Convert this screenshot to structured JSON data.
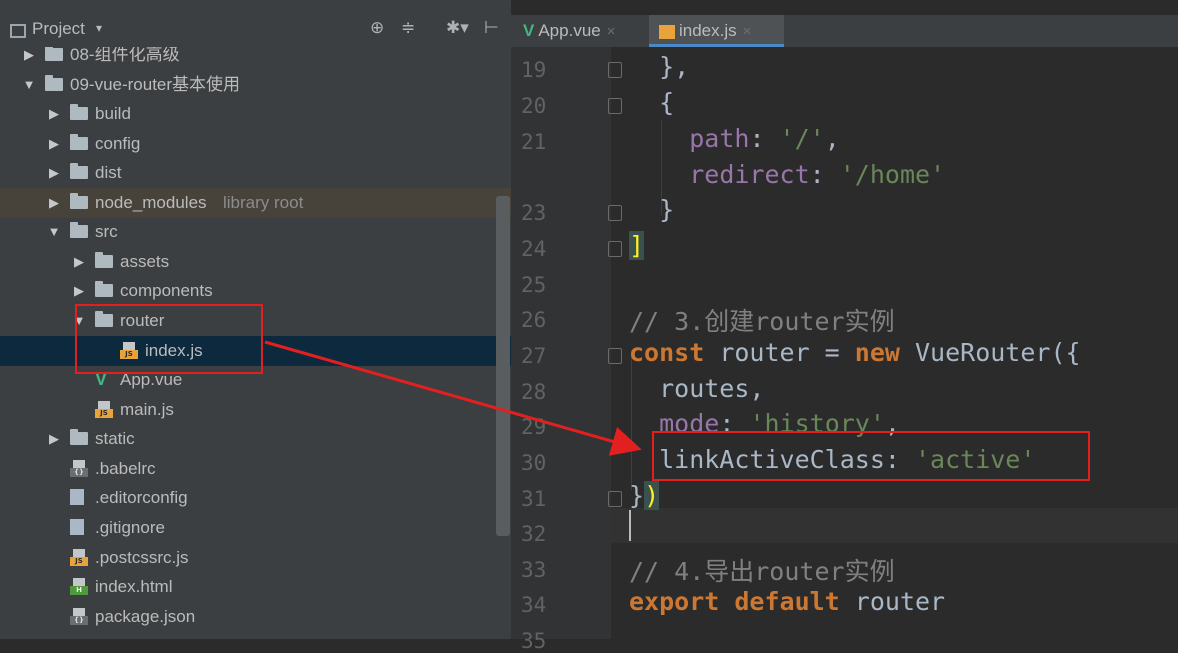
{
  "project_panel": {
    "title": "Project",
    "caret": "▾",
    "tools": [
      "⊕",
      "≑",
      "✱▾",
      "⊢"
    ],
    "tree": [
      {
        "label": "08-组件化高级",
        "kind": "folder",
        "expanded": false
      },
      {
        "label": "09-vue-router基本使用",
        "kind": "folder",
        "expanded": true
      },
      {
        "label": "build",
        "kind": "folder",
        "expanded": false
      },
      {
        "label": "config",
        "kind": "folder",
        "expanded": false
      },
      {
        "label": "dist",
        "kind": "folder",
        "expanded": false
      },
      {
        "label": "node_modules",
        "extra": "library root",
        "kind": "folder",
        "expanded": false
      },
      {
        "label": "src",
        "kind": "folder",
        "expanded": true
      },
      {
        "label": "assets",
        "kind": "folder",
        "expanded": false
      },
      {
        "label": "components",
        "kind": "folder",
        "expanded": false
      },
      {
        "label": "router",
        "kind": "folder",
        "expanded": true
      },
      {
        "label": "index.js",
        "kind": "js",
        "selected": true
      },
      {
        "label": "App.vue",
        "kind": "vue"
      },
      {
        "label": "main.js",
        "kind": "js"
      },
      {
        "label": "static",
        "kind": "folder",
        "expanded": false
      },
      {
        "label": ".babelrc",
        "kind": "config"
      },
      {
        "label": ".editorconfig",
        "kind": "text"
      },
      {
        "label": ".gitignore",
        "kind": "text"
      },
      {
        "label": ".postcssrc.js",
        "kind": "js"
      },
      {
        "label": "index.html",
        "kind": "html"
      },
      {
        "label": "package.json",
        "kind": "config"
      }
    ]
  },
  "editor": {
    "tabs": [
      {
        "label": "App.vue",
        "icon": "vue-icon",
        "active": false
      },
      {
        "label": "index.js",
        "icon": "js-file-icon",
        "active": true
      }
    ],
    "close_glyph": "×",
    "lines": [
      {
        "no": "19",
        "code": "  },"
      },
      {
        "no": "20",
        "code": "  {"
      },
      {
        "no": "21",
        "code": "    path: '/',"
      },
      {
        "no": "",
        "code": "    redirect: '/home'"
      },
      {
        "no": "23",
        "code": "  }"
      },
      {
        "no": "24",
        "code": "]"
      },
      {
        "no": "25",
        "code": ""
      },
      {
        "no": "26",
        "code": "// 3.创建router实例"
      },
      {
        "no": "27",
        "code": "const router = new VueRouter({"
      },
      {
        "no": "28",
        "code": "  routes,"
      },
      {
        "no": "29",
        "code": "  mode: 'history',"
      },
      {
        "no": "30",
        "code": "  linkActiveClass: 'active'"
      },
      {
        "no": "31",
        "code": "})"
      },
      {
        "no": "32",
        "code": ""
      },
      {
        "no": "33",
        "code": "// 4.导出router实例"
      },
      {
        "no": "34",
        "code": "export default router"
      },
      {
        "no": "35",
        "code": ""
      }
    ]
  },
  "colors": {
    "panel_bg": "#3c3f41",
    "editor_bg": "#2b2b2b",
    "keyword": "#cc7832",
    "string": "#6a8759",
    "property": "#9876aa",
    "comment": "#808080",
    "annotation_red": "#e32020"
  }
}
